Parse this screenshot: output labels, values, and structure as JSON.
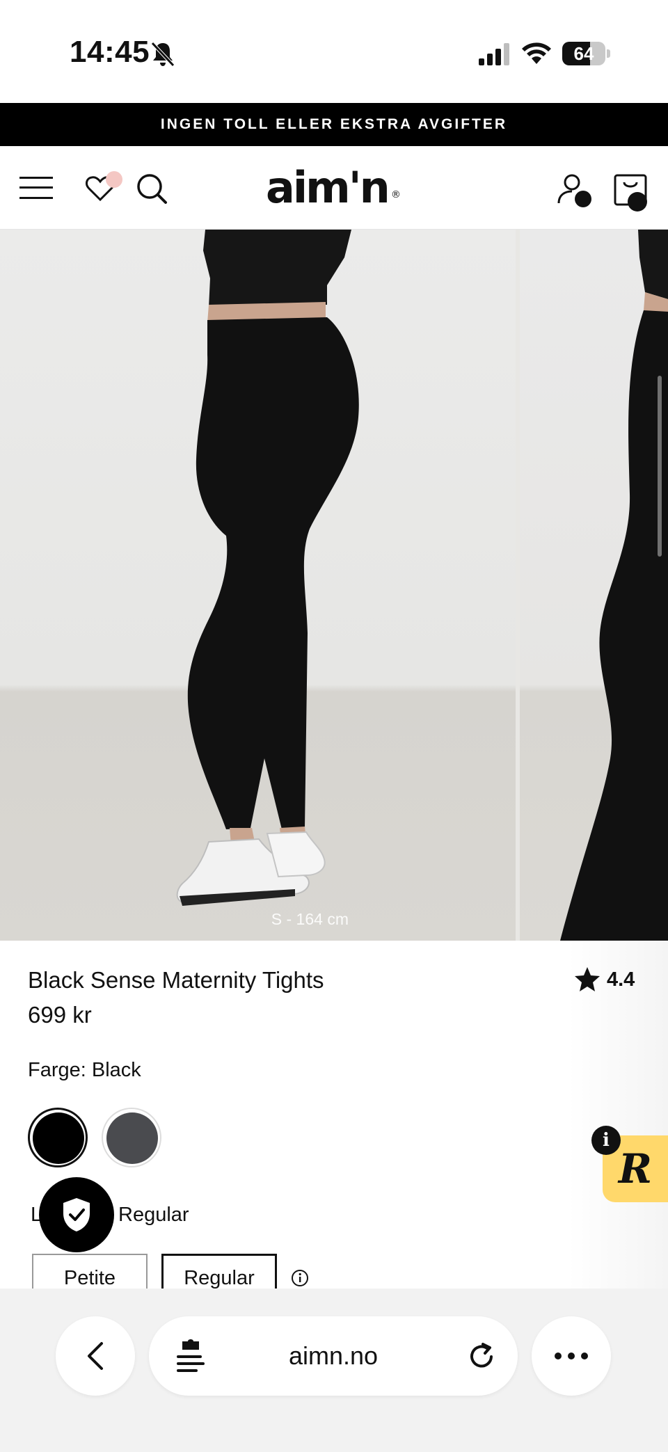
{
  "status_bar": {
    "time": "14:45",
    "battery_level": "64",
    "battery_fraction": 0.64
  },
  "promo": {
    "text": "INGEN TOLL ELLER EKSTRA AVGIFTER"
  },
  "header": {
    "logo": "aim'n",
    "logo_mark": "®",
    "icons": [
      "menu-icon",
      "wishlist-heart-icon",
      "search-icon",
      "account-icon",
      "cart-icon"
    ]
  },
  "gallery": {
    "caption": "S - 164 cm"
  },
  "product": {
    "title": "Black Sense Maternity Tights",
    "price": "699 kr",
    "rating": "4.4",
    "color_label": "Farge: Black",
    "swatches": [
      {
        "name": "Black",
        "hex": "#000000",
        "selected": true
      },
      {
        "name": "Dark grey",
        "hex": "#4a4b4f",
        "selected": false
      }
    ],
    "length_label_prefix": "L",
    "length_label_value": "Regular",
    "sizes": [
      {
        "label": "Petite",
        "selected": false
      },
      {
        "label": "Regular",
        "selected": true
      }
    ]
  },
  "reviews_widget": {
    "badge": "R",
    "info": "i"
  },
  "browser": {
    "url": "aimn.no"
  },
  "colors": {
    "promo_bg": "#000000",
    "reviews_widget_bg": "#ffd86b",
    "wishlist_dot": "#f4c7c3"
  }
}
